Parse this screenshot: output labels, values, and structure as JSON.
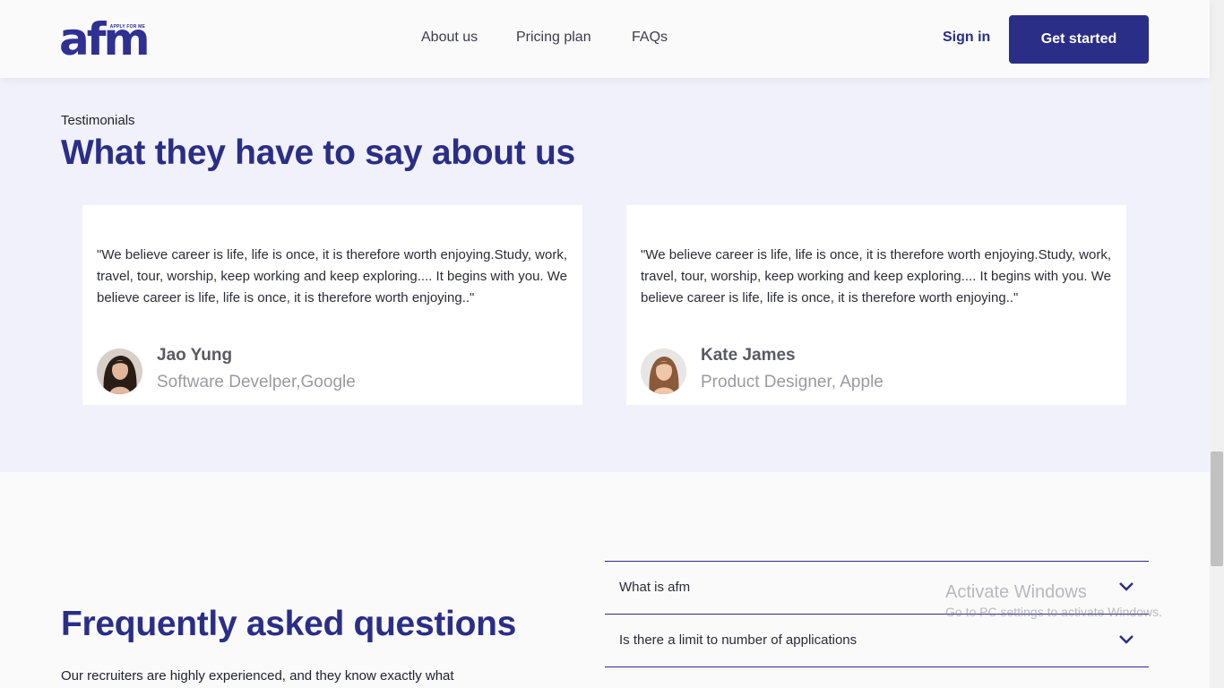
{
  "nav": {
    "logo_text": "afm",
    "logo_tagline": "APPLY FOR ME",
    "links": [
      "About us",
      "Pricing plan",
      "FAQs"
    ],
    "signin_label": "Sign in",
    "cta_label": "Get started"
  },
  "testimonials": {
    "eyebrow": "Testimonials",
    "title": "What they have to say about us",
    "cards": [
      {
        "quote": "\"We believe career is life, life is once, it is therefore worth enjoying.Study, work, travel, tour, worship, keep working and keep exploring.... It begins with you. We believe career is life, life is once, it is therefore worth enjoying..\"",
        "name": "Jao Yung",
        "role": "Software Develper,Google"
      },
      {
        "quote": "\"We believe career is life, life is once, it is therefore worth enjoying.Study, work, travel, tour, worship, keep working and keep exploring.... It begins with you. We believe career is life, life is once, it is therefore worth enjoying..\"",
        "name": "Kate James",
        "role": "Product Designer, Apple"
      }
    ]
  },
  "faq": {
    "title": "Frequently asked questions",
    "intro": "Our recruiters are highly experienced, and they know exactly what",
    "items": [
      {
        "question": "What is afm"
      },
      {
        "question": "Is there a limit to number of applications"
      }
    ]
  },
  "watermark": {
    "line1": "Activate Windows",
    "line2": "Go to PC settings to activate Windows."
  },
  "colors": {
    "brand": "#2b2e86",
    "section_bg": "#f1f1fb",
    "page_bg": "#fafafb"
  }
}
